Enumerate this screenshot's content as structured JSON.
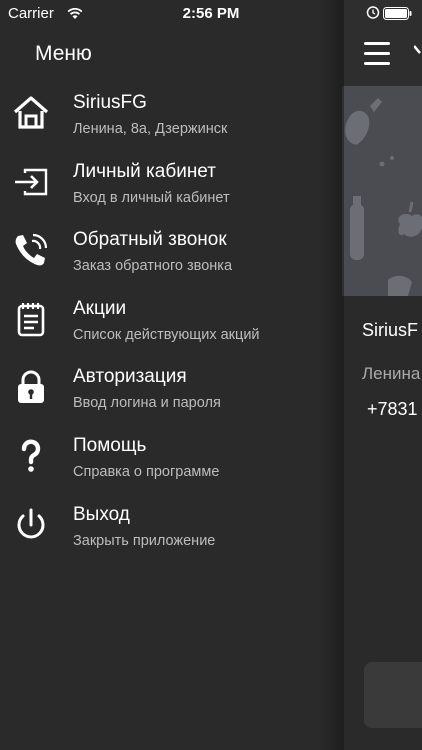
{
  "status_bar": {
    "carrier": "Carrier",
    "time": "2:56 PM",
    "wifi_icon": "wifi-icon",
    "alarm_icon": "alarm-icon",
    "battery_icon": "battery-icon"
  },
  "drawer": {
    "title": "Меню",
    "items": [
      {
        "icon": "home-icon",
        "label": "SiriusFG",
        "subtitle": "Ленина, 8а, Дзержинск"
      },
      {
        "icon": "login-icon",
        "label": "Личный кабинет",
        "subtitle": "Вход в личный кабинет"
      },
      {
        "icon": "phone-callback-icon",
        "label": "Обратный звонок",
        "subtitle": "Заказ обратного звонка"
      },
      {
        "icon": "notepad-icon",
        "label": "Акции",
        "subtitle": "Список действующих акций"
      },
      {
        "icon": "lock-icon",
        "label": "Авторизация",
        "subtitle": "Ввод логина и пароля"
      },
      {
        "icon": "help-icon",
        "label": "Помощь",
        "subtitle": "Справка о программе"
      },
      {
        "icon": "power-icon",
        "label": "Выход",
        "subtitle": "Закрыть приложение"
      }
    ]
  },
  "main": {
    "menu_icon": "hamburger-icon",
    "card": {
      "name": "SiriusF",
      "address": "Ленина",
      "phone": "+7831"
    }
  },
  "colors": {
    "drawer_background": "#2a2a2a",
    "banner_background": "#4a4c52",
    "subtitle_text": "#bdbdbd",
    "text": "#ffffff"
  }
}
